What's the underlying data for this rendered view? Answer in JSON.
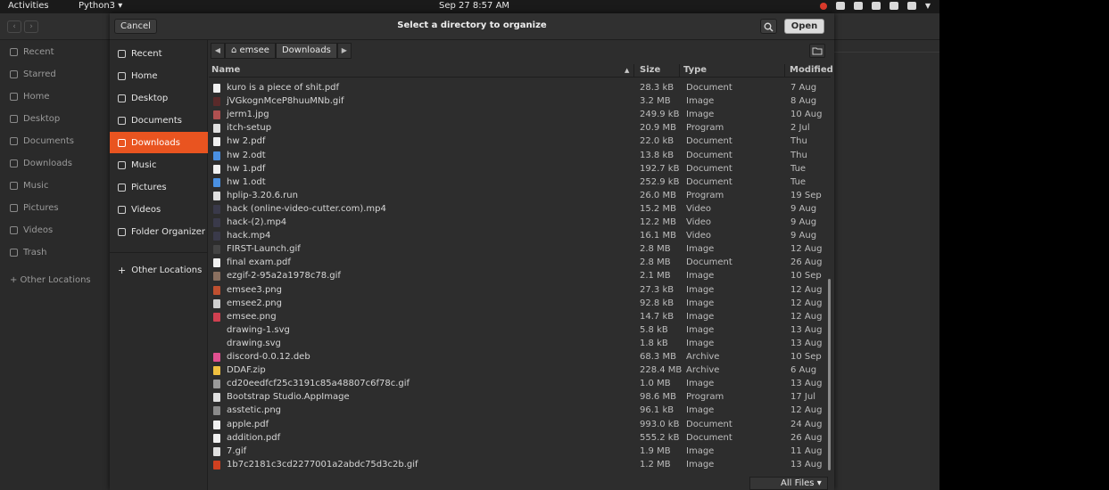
{
  "topbar": {
    "activities": "Activities",
    "app_menu": "Python3 ▾",
    "clock": "Sep 27  8:57 AM",
    "tray_icons": [
      "record-icon",
      "discord-icon",
      "wifi-icon",
      "volume-icon",
      "mic-icon",
      "battery-icon",
      "chevron-down-icon"
    ]
  },
  "background_window": {
    "sidebar": [
      "Recent",
      "Starred",
      "Home",
      "Desktop",
      "Documents",
      "Downloads",
      "Music",
      "Pictures",
      "Videos",
      "Trash",
      "+ Other Locations"
    ]
  },
  "dialog": {
    "title": "Select a directory to organize",
    "cancel_label": "Cancel",
    "open_label": "Open",
    "sidebar": [
      {
        "label": "Recent",
        "icon": "clock-icon"
      },
      {
        "label": "Home",
        "icon": "home-icon"
      },
      {
        "label": "Desktop",
        "icon": "folder-icon"
      },
      {
        "label": "Documents",
        "icon": "document-icon"
      },
      {
        "label": "Downloads",
        "icon": "download-icon",
        "active": true
      },
      {
        "label": "Music",
        "icon": "music-icon"
      },
      {
        "label": "Pictures",
        "icon": "picture-icon"
      },
      {
        "label": "Videos",
        "icon": "video-icon"
      },
      {
        "label": "Folder Organizer",
        "icon": "folder-icon"
      },
      {
        "label": "Other Locations",
        "icon": "plus-icon"
      }
    ],
    "path": [
      "emsee",
      "Downloads"
    ],
    "columns": {
      "name": "Name",
      "size": "Size",
      "type": "Type",
      "modified": "Modified"
    },
    "files": [
      {
        "name": "kuro is a piece of shit.pdf",
        "size": "28.3 kB",
        "type": "Document",
        "modified": "7 Aug",
        "color": "#f0f0f0"
      },
      {
        "name": "jVGkognMceP8huuMNb.gif",
        "size": "3.2 MB",
        "type": "Image",
        "modified": "8 Aug",
        "color": "#5a2a2a"
      },
      {
        "name": "jerm1.jpg",
        "size": "249.9 kB",
        "type": "Image",
        "modified": "10 Aug",
        "color": "#b05050"
      },
      {
        "name": "itch-setup",
        "size": "20.9 MB",
        "type": "Program",
        "modified": "2 Jul",
        "color": "#e0e0e0"
      },
      {
        "name": "hw 2.pdf",
        "size": "22.0 kB",
        "type": "Document",
        "modified": "Thu",
        "color": "#f0f0f0"
      },
      {
        "name": "hw 2.odt",
        "size": "13.8 kB",
        "type": "Document",
        "modified": "Thu",
        "color": "#4a90e2"
      },
      {
        "name": "hw 1.pdf",
        "size": "192.7 kB",
        "type": "Document",
        "modified": "Tue",
        "color": "#f0f0f0"
      },
      {
        "name": "hw 1.odt",
        "size": "252.9 kB",
        "type": "Document",
        "modified": "Tue",
        "color": "#4a90e2"
      },
      {
        "name": "hplip-3.20.6.run",
        "size": "26.0 MB",
        "type": "Program",
        "modified": "19 Sep",
        "color": "#e0e0e0"
      },
      {
        "name": "hack (online-video-cutter.com).mp4",
        "size": "15.2 MB",
        "type": "Video",
        "modified": "9 Aug",
        "color": "#3a3a4a"
      },
      {
        "name": "hack-(2).mp4",
        "size": "12.2 MB",
        "type": "Video",
        "modified": "9 Aug",
        "color": "#3a3a4a"
      },
      {
        "name": "hack.mp4",
        "size": "16.1 MB",
        "type": "Video",
        "modified": "9 Aug",
        "color": "#3a3a4a"
      },
      {
        "name": "FIRST-Launch.gif",
        "size": "2.8 MB",
        "type": "Image",
        "modified": "12 Aug",
        "color": "#444444"
      },
      {
        "name": "final exam.pdf",
        "size": "2.8 MB",
        "type": "Document",
        "modified": "26 Aug",
        "color": "#f0f0f0"
      },
      {
        "name": "ezgif-2-95a2a1978c78.gif",
        "size": "2.1 MB",
        "type": "Image",
        "modified": "10 Sep",
        "color": "#8a7060"
      },
      {
        "name": "emsee3.png",
        "size": "27.3 kB",
        "type": "Image",
        "modified": "12 Aug",
        "color": "#c05030"
      },
      {
        "name": "emsee2.png",
        "size": "92.8 kB",
        "type": "Image",
        "modified": "12 Aug",
        "color": "#d0d0d0"
      },
      {
        "name": "emsee.png",
        "size": "14.7 kB",
        "type": "Image",
        "modified": "12 Aug",
        "color": "#d04050"
      },
      {
        "name": "drawing-1.svg",
        "size": "5.8 kB",
        "type": "Image",
        "modified": "13 Aug",
        "color": "#2d2d2d"
      },
      {
        "name": "drawing.svg",
        "size": "1.8 kB",
        "type": "Image",
        "modified": "13 Aug",
        "color": "#2d2d2d"
      },
      {
        "name": "discord-0.0.12.deb",
        "size": "68.3 MB",
        "type": "Archive",
        "modified": "10 Sep",
        "color": "#e05090"
      },
      {
        "name": "DDAF.zip",
        "size": "228.4 MB",
        "type": "Archive",
        "modified": "6 Aug",
        "color": "#f0c040"
      },
      {
        "name": "cd20eedfcf25c3191c85a48807c6f78c.gif",
        "size": "1.0 MB",
        "type": "Image",
        "modified": "13 Aug",
        "color": "#9a9a9a"
      },
      {
        "name": "Bootstrap Studio.AppImage",
        "size": "98.6 MB",
        "type": "Program",
        "modified": "17 Jul",
        "color": "#e0e0e0"
      },
      {
        "name": "asstetic.png",
        "size": "96.1 kB",
        "type": "Image",
        "modified": "12 Aug",
        "color": "#8a8a8a"
      },
      {
        "name": "apple.pdf",
        "size": "993.0 kB",
        "type": "Document",
        "modified": "24 Aug",
        "color": "#f0f0f0"
      },
      {
        "name": "addition.pdf",
        "size": "555.2 kB",
        "type": "Document",
        "modified": "26 Aug",
        "color": "#f0f0f0"
      },
      {
        "name": "7.gif",
        "size": "1.9 MB",
        "type": "Image",
        "modified": "11 Aug",
        "color": "#e0e0e0"
      },
      {
        "name": "1b7c2181c3cd2277001a2abdc75d3c2b.gif",
        "size": "1.2 MB",
        "type": "Image",
        "modified": "13 Aug",
        "color": "#d04020"
      }
    ],
    "filter_label": "All Files ▾"
  }
}
